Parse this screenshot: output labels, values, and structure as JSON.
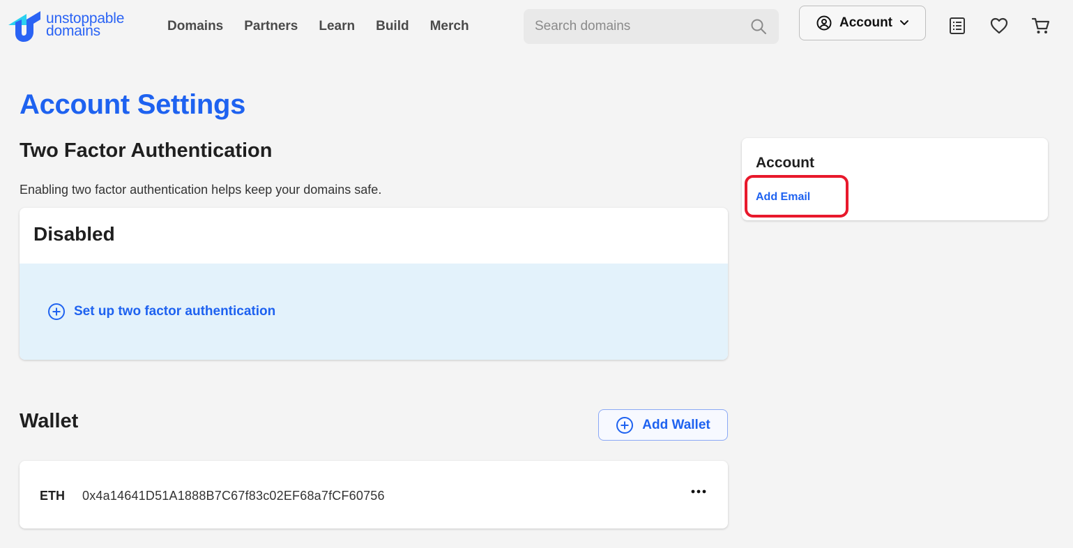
{
  "brand": {
    "line1": "unstoppable",
    "line2": "domains",
    "color": "#2a63f4"
  },
  "nav": {
    "items": [
      {
        "label": "Domains"
      },
      {
        "label": "Partners"
      },
      {
        "label": "Learn"
      },
      {
        "label": "Build"
      },
      {
        "label": "Merch"
      }
    ]
  },
  "search": {
    "placeholder": "Search domains",
    "icon": "search-icon"
  },
  "header": {
    "account_label": "Account",
    "icons": [
      "account-circle-icon",
      "chevron-down-icon",
      "orders-list-icon",
      "heart-icon",
      "cart-icon"
    ]
  },
  "page": {
    "title": "Account Settings",
    "accent_color": "#1e62f0"
  },
  "two_factor": {
    "title": "Two Factor Authentication",
    "description": "Enabling two factor authentication helps keep your domains safe.",
    "status": "Disabled",
    "setup_label": "Set up two factor authentication",
    "panel_color": "#e3f2fb"
  },
  "wallet": {
    "title": "Wallet",
    "add_label": "Add Wallet",
    "entries": [
      {
        "chain": "ETH",
        "address": "0x4a14641D51A1888B7C67f83c02EF68a7fCF60756"
      }
    ]
  },
  "sidebar": {
    "title": "Account",
    "link_label": "Add Email",
    "highlight_color": "#e8192c"
  }
}
